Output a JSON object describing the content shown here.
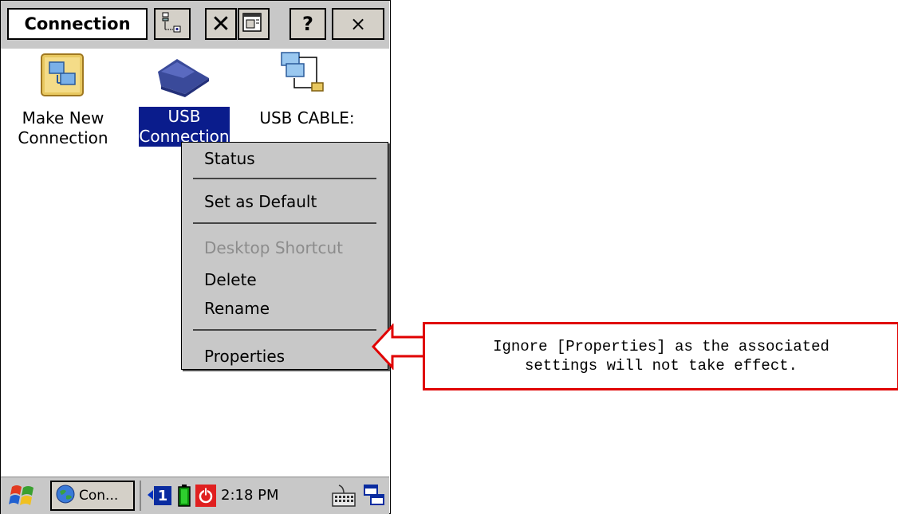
{
  "window": {
    "title": "Connection",
    "help_label": "?",
    "close_label": "×",
    "delete_label": "✕"
  },
  "icons": [
    {
      "line1": "Make New",
      "line2": "Connection",
      "icon": "make-new-connection-icon",
      "selected": false
    },
    {
      "line1": "USB",
      "line2": "Connection",
      "icon": "usb-connection-icon",
      "selected": true
    },
    {
      "line1": "USB CABLE:",
      "line2": "",
      "icon": "network-cable-icon",
      "selected": false
    }
  ],
  "context_menu": {
    "items": [
      {
        "label": "Status",
        "enabled": true
      },
      {
        "label": "Set as Default",
        "enabled": true
      },
      {
        "label": "Desktop Shortcut",
        "enabled": false
      },
      {
        "label": "Delete",
        "enabled": true
      },
      {
        "label": "Rename",
        "enabled": true
      },
      {
        "label": "Properties",
        "enabled": true
      }
    ]
  },
  "taskbar": {
    "task_label": "Con...",
    "tray_number": "1",
    "clock": "2:18 PM"
  },
  "callout": {
    "line1": "Ignore [Properties] as the associated",
    "line2": "settings will not take effect.",
    "color": "#e00000"
  }
}
